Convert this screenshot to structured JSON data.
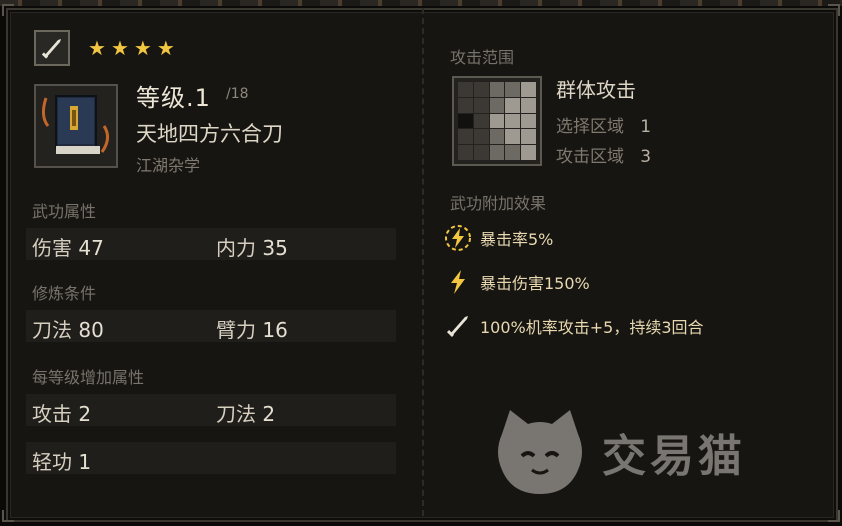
{
  "skill": {
    "stars": [
      "★",
      "★",
      "★",
      "★"
    ],
    "level": "等级.1",
    "level_max": "/18",
    "name": "天地四方六合刀",
    "category": "江湖杂学"
  },
  "attributes": {
    "label": "武功属性",
    "left_name": "伤害",
    "left_value": "47",
    "right_name": "内力",
    "right_value": "35"
  },
  "requirements": {
    "label": "修炼条件",
    "left_name": "刀法",
    "left_value": "80",
    "right_name": "臂力",
    "right_value": "16"
  },
  "per_level": {
    "label": "每等级增加属性",
    "row1_left_name": "攻击",
    "row1_left_value": "2",
    "row1_right_name": "刀法",
    "row1_right_value": "2",
    "row2_left_name": "轻功",
    "row2_left_value": "1"
  },
  "attack_range": {
    "label": "攻击范围",
    "type": "群体攻击",
    "select_label": "选择区域",
    "select_value": "1",
    "attack_label": "攻击区域",
    "attack_value": "3"
  },
  "effects": {
    "label": "武功附加效果",
    "items": [
      "暴击率5%",
      "暴击伤害150%",
      "100%机率攻击+5，持续3回合"
    ]
  },
  "colors": {
    "accent_gold": "#f2c640",
    "effect_text": "#e7d8b0",
    "panel_bg": "#171512"
  },
  "icons": {
    "weapon": "sword-icon",
    "book": "book-icon",
    "crit_rate": "lightning-circle-icon",
    "crit_damage": "lightning-icon",
    "attack_buff": "sword-icon"
  },
  "watermark": {
    "text": "交易猫"
  }
}
